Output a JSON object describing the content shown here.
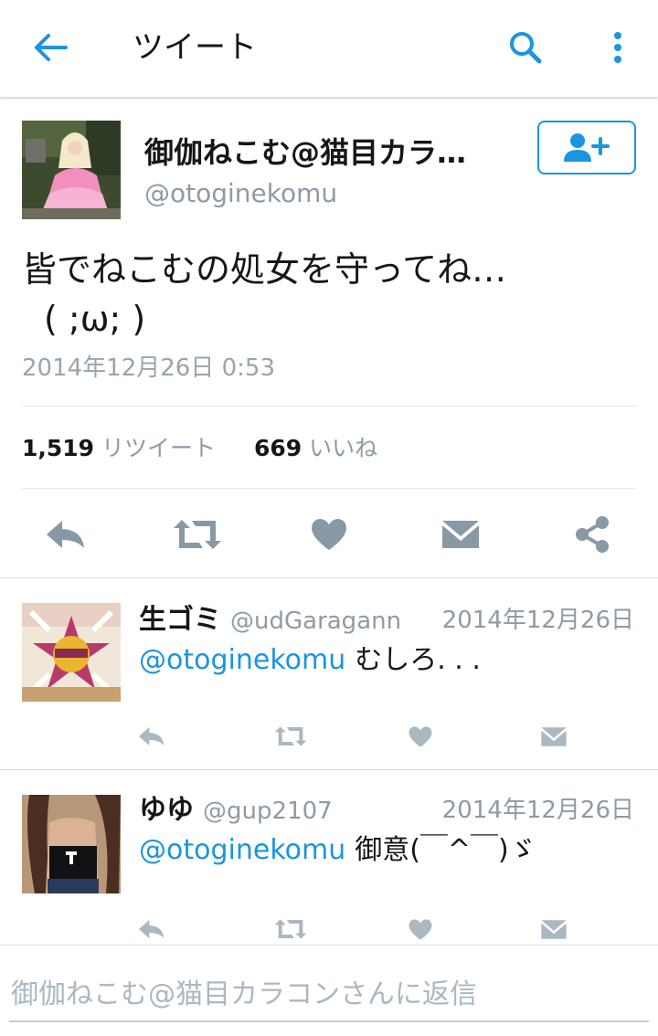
{
  "app_bar": {
    "title": "ツイート",
    "icons": [
      "back-arrow-icon",
      "search-icon",
      "more-vert-icon"
    ],
    "accent_color": "#1b95e0"
  },
  "tweet": {
    "display_name": "御伽ねこむ@猫目カラ…",
    "handle": "@otoginekomu",
    "follow_icon": "add-user-icon",
    "text_line1": "皆でねこむの処女を守ってね…",
    "text_line2": "( ;ω; )",
    "timestamp": "2014年12月26日 0:53",
    "retweet_count": "1,519",
    "retweet_label": "リツイート",
    "like_count": "669",
    "like_label": "いいね",
    "actions": [
      "reply-icon",
      "retweet-icon",
      "like-icon",
      "message-icon",
      "share-icon"
    ]
  },
  "replies": [
    {
      "name": "生ゴミ",
      "handle": "@udGaragann",
      "date": "2014年12月26日",
      "mention": "@otoginekomu",
      "text": "むしろ. . ."
    },
    {
      "name": "ゆゆ",
      "handle": "@gup2107",
      "date": "2014年12月26日",
      "mention": "@otoginekomu",
      "text": "御意(￣^￣)ゞ"
    }
  ],
  "reply_bar": {
    "placeholder": "御伽ねこむ@猫目カラコンさんに返信"
  }
}
